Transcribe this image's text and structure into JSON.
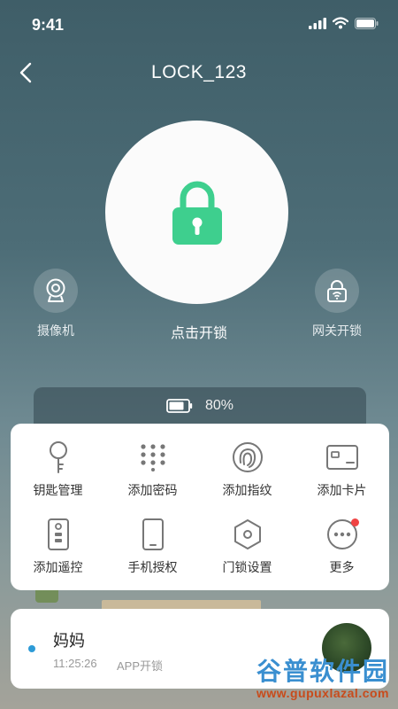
{
  "status_bar": {
    "time": "9:41"
  },
  "header": {
    "title": "LOCK_123"
  },
  "lock": {
    "unlock_label": "点击开锁"
  },
  "side_buttons": {
    "camera_label": "摄像机",
    "gateway_label": "网关开锁"
  },
  "battery": {
    "level_text": "80%",
    "level": 0.8
  },
  "menu": {
    "items": [
      {
        "label": "钥匙管理",
        "icon": "key-icon"
      },
      {
        "label": "添加密码",
        "icon": "keypad-icon"
      },
      {
        "label": "添加指纹",
        "icon": "fingerprint-icon"
      },
      {
        "label": "添加卡片",
        "icon": "card-icon"
      },
      {
        "label": "添加遥控",
        "icon": "remote-icon"
      },
      {
        "label": "手机授权",
        "icon": "phone-icon"
      },
      {
        "label": "门锁设置",
        "icon": "settings-hex-icon"
      },
      {
        "label": "更多",
        "icon": "more-icon",
        "badge": true
      }
    ]
  },
  "log": {
    "name": "妈妈",
    "time": "11:25:26",
    "method": "APP开锁"
  },
  "watermark": {
    "title": "谷普软件园",
    "url": "www.gupuxlazal.com"
  },
  "colors": {
    "accent_green": "#3ecf8e",
    "log_dot": "#2d9bd7",
    "badge_red": "#f04343"
  }
}
